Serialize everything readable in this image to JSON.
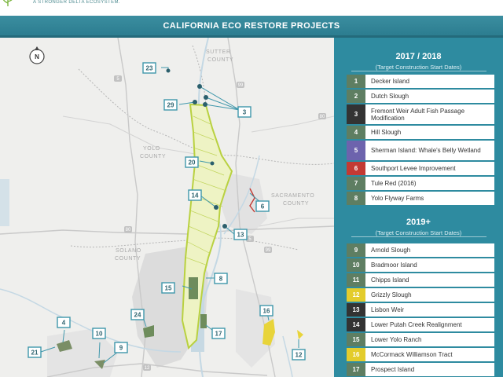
{
  "header": {
    "tagline": "A STRONGER DELTA ECOSYSTEM.",
    "title": "CALIFORNIA ECO RESTORE PROJECTS"
  },
  "map": {
    "north_label": "N",
    "county_labels": {
      "sutter": [
        "SUTTER",
        "COUNTY"
      ],
      "yolo": [
        "YOLO",
        "COUNTY"
      ],
      "sacramento": [
        "SACRAMENTO",
        "COUNTY"
      ],
      "solano": [
        "SOLANO",
        "COUNTY"
      ]
    },
    "highway_labels": [
      "99",
      "5",
      "80",
      "5",
      "99",
      "80",
      "12"
    ],
    "site_badges": [
      "23",
      "29",
      "3",
      "20",
      "14",
      "6",
      "13",
      "8",
      "15",
      "24",
      "16",
      "17",
      "4",
      "10",
      "9",
      "21",
      "12"
    ],
    "colors": {
      "bypass": "#c9dc55",
      "marker": "#2b5f6c",
      "badge_border": "#3f97ab",
      "water": "#c7d9e3",
      "urban": "#d9d9d9"
    }
  },
  "panel": {
    "section1": {
      "heading": "2017 / 2018",
      "subheading": "(Target Construction Start Dates)",
      "projects": [
        {
          "num": "1",
          "name": "Decker Island",
          "color": "#5e7e62"
        },
        {
          "num": "2",
          "name": "Dutch Slough",
          "color": "#5e7e62"
        },
        {
          "num": "3",
          "name": "Fremont Weir Adult Fish Passage Modification",
          "color": "#333333"
        },
        {
          "num": "4",
          "name": "Hill Slough",
          "color": "#5e7e62"
        },
        {
          "num": "5",
          "name": "Sherman Island: Whale's Belly Wetland",
          "color": "#6d63ad"
        },
        {
          "num": "6",
          "name": "Southport Levee Improvement",
          "color": "#c33a33"
        },
        {
          "num": "7",
          "name": "Tule Red (2016)",
          "color": "#5e7e62"
        },
        {
          "num": "8",
          "name": "Yolo Flyway Farms",
          "color": "#5e7e62"
        }
      ]
    },
    "section2": {
      "heading": "2019+",
      "subheading": "(Target Construction Start Dates)",
      "projects": [
        {
          "num": "9",
          "name": "Arnold Slough",
          "color": "#5e7e62"
        },
        {
          "num": "10",
          "name": "Bradmoor Island",
          "color": "#5e7e62"
        },
        {
          "num": "11",
          "name": "Chipps Island",
          "color": "#5e7e62"
        },
        {
          "num": "12",
          "name": "Grizzly Slough",
          "color": "#e3cc2c"
        },
        {
          "num": "13",
          "name": "Lisbon Weir",
          "color": "#333333"
        },
        {
          "num": "14",
          "name": "Lower Putah Creek Realignment",
          "color": "#333333"
        },
        {
          "num": "15",
          "name": "Lower Yolo Ranch",
          "color": "#5e7e62"
        },
        {
          "num": "16",
          "name": "McCormack Williamson Tract",
          "color": "#e3cc2c"
        },
        {
          "num": "17",
          "name": "Prospect Island",
          "color": "#5e7e62"
        }
      ]
    }
  }
}
